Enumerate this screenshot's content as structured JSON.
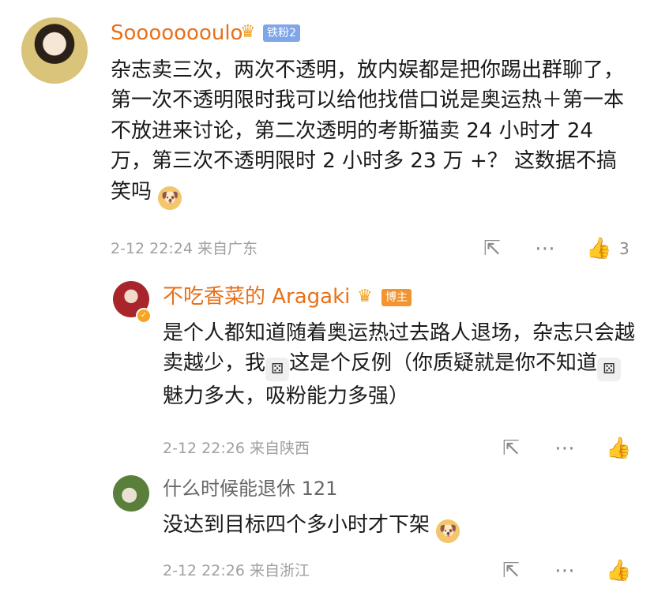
{
  "comments": [
    {
      "username": "Soooooooulo",
      "badge": "铁粉2",
      "text_parts": [
        "杂志卖三次，两次不透明，放内娱都是把你踢出群聊了，第一次不透明限时我可以给他找借口说是奥运热＋第一本不放进来讨论，第二次透明的考斯猫卖 24 小时才 24 万，第三次不透明限时 2 小时多 23 万 +？ 这数据不搞笑吗"
      ],
      "emoji_doge": "🐶",
      "time": "2-12 22:24",
      "location": "来自广东",
      "like_count": "3"
    },
    {
      "username": "不吃香菜的 Aragaki",
      "badge": "博主",
      "text_1": "是个人都知道随着奥运热过去路人退场，杂志只会越卖越少，我",
      "text_2": "这是个反例（你质疑就是你不知道",
      "text_3": "魅力多大，吸粉能力多强）",
      "emoji_dice": "⚄",
      "time": "2-12 22:26",
      "location": "来自陕西"
    },
    {
      "username": "什么时候能退休 121",
      "text": "没达到目标四个多小时才下架",
      "emoji_doge": "🐶",
      "time": "2-12 22:26",
      "location": "来自浙江"
    }
  ],
  "icons": {
    "share": "share-icon",
    "comment": "comment-icon",
    "like": "thumbs-up-icon",
    "crown": "crown-icon",
    "verified": "verified-icon"
  },
  "colors": {
    "username": "#e8701a",
    "fan_badge": "#7fa6e6",
    "author_badge": "#f29431",
    "meta": "#a0a0a0"
  }
}
